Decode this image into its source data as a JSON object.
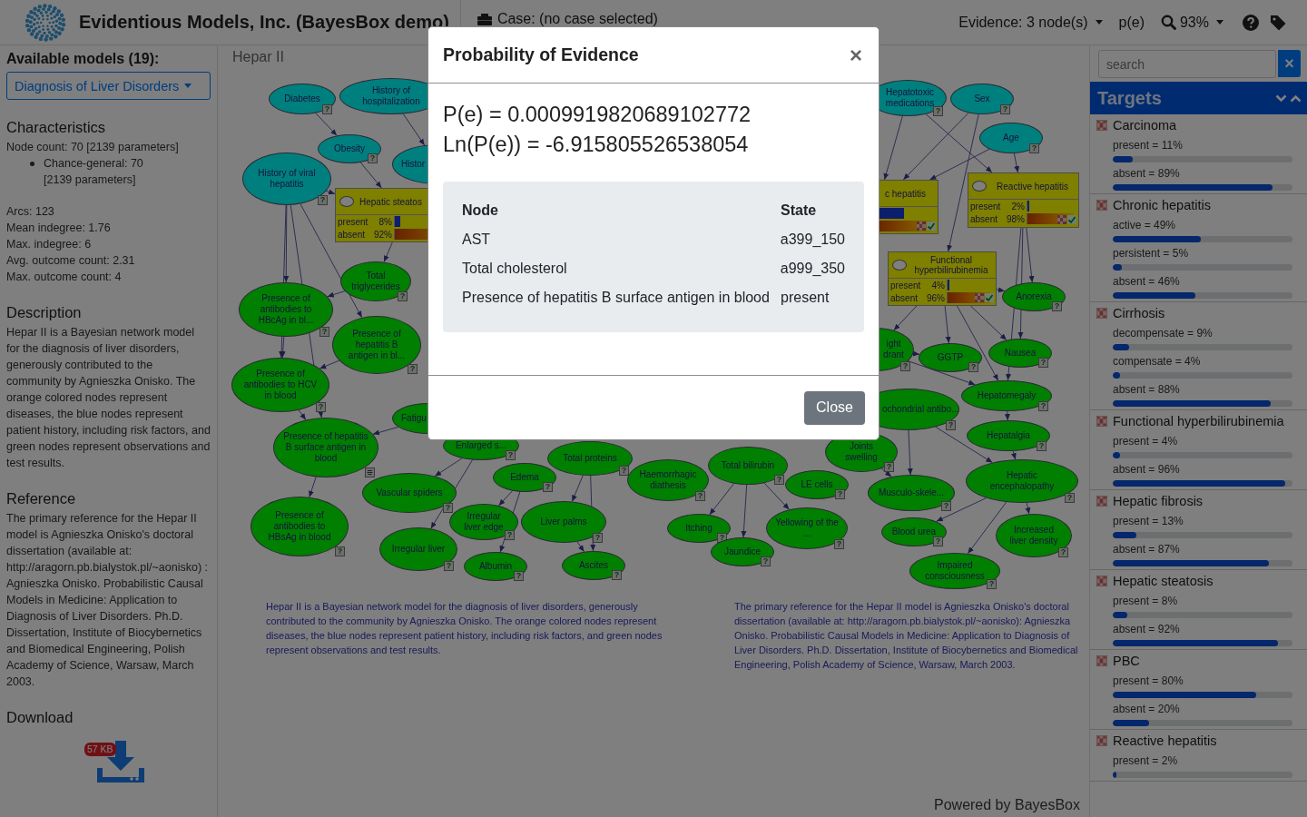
{
  "header": {
    "title": "Evidentious Models, Inc. (BayesBox demo)",
    "case": "Case: (no case selected)",
    "evidence": "Evidence: 3 node(s)",
    "pe": "p(e)",
    "zoom": "93%"
  },
  "sidebar": {
    "heading": "Available models (19):",
    "model": "Diagnosis of Liver Disorders",
    "characteristics": {
      "title": "Characteristics",
      "node_count": "Node count: 70 [2139 parameters]",
      "node_types": [
        "Chance-general: 70 [2139 parameters]"
      ],
      "stats": [
        "Arcs: 123",
        "Mean indegree: 1.76",
        "Max. indegree: 6",
        "Avg. outcome count: 2.31",
        "Max. outcome count: 4"
      ]
    },
    "description": {
      "title": "Description",
      "text": "Hepar II is a Bayesian network model for the diagnosis of liver disorders, generously contributed to the community by Agnieszka Onisko. The orange colored nodes represent diseases, the blue nodes represent patient history, including risk factors, and green nodes represent observations and test results."
    },
    "reference": {
      "title": "Reference",
      "text": "The primary reference for the Hepar II model is Agnieszka Onisko's doctoral dissertation (available at: http://aragorn.pb.bialystok.pl/~aonisko) : Agnieszka Onisko. Probabilistic Causal Models in Medicine: Application to Diagnosis of Liver Disorders. Ph.D. Dissertation, Institute of Biocybernetics and Biomedical Engineering, Polish Academy of Science, Warsaw, March 2003."
    },
    "download": {
      "title": "Download",
      "size": "57 KB"
    }
  },
  "canvas": {
    "title": "Hepar II",
    "nodes": [
      {
        "label": "Diabetes",
        "kind": "history",
        "mark": "?"
      },
      {
        "label": "History of hospitalization",
        "kind": "history"
      },
      {
        "label": "Hepatotoxic medications",
        "kind": "history",
        "mark": "?"
      },
      {
        "label": "Sex",
        "kind": "history",
        "mark": "?"
      },
      {
        "label": "Obesity",
        "kind": "history",
        "mark": "?"
      },
      {
        "label": "History of viral hepatitis",
        "kind": "history",
        "mark": "?"
      },
      {
        "label": "Histor",
        "kind": "history"
      },
      {
        "label": "Age",
        "kind": "history",
        "mark": "?"
      },
      {
        "label": "Presence of antibodies to HBcAg in bl...",
        "kind": "observation",
        "mark": "?"
      },
      {
        "label": "Total triglycerides",
        "kind": "observation",
        "mark": "?"
      },
      {
        "label": "Anorexia",
        "kind": "observation",
        "mark": "?"
      },
      {
        "label": "Presence of antibodies to HCV in blood",
        "kind": "observation",
        "mark": "?"
      },
      {
        "label": "Presence of hepatitis B antigen in bl...",
        "kind": "observation",
        "mark": "?"
      },
      {
        "label": "ight drant",
        "kind": "observation",
        "mark": "?"
      },
      {
        "label": "GGTP",
        "kind": "observation",
        "mark": "?"
      },
      {
        "label": "Nausea",
        "kind": "observation",
        "mark": "?"
      },
      {
        "label": "Presence of hepatitis B surface antigen in blood",
        "kind": "observation",
        "list_badge": true
      },
      {
        "label": "Fatigu",
        "kind": "observation"
      },
      {
        "label": "ochondrial antibo...",
        "kind": "observation",
        "mark": "?"
      },
      {
        "label": "Hepatomegaly",
        "kind": "observation",
        "mark": "?"
      },
      {
        "label": "Enlarged s...",
        "kind": "observation",
        "mark": "?"
      },
      {
        "label": "Presence of antibodies to HBsAg in blood",
        "kind": "observation",
        "mark": "?"
      },
      {
        "label": "Vascular spiders",
        "kind": "observation",
        "mark": "?"
      },
      {
        "label": "Edema",
        "kind": "observation",
        "mark": "?"
      },
      {
        "label": "Total proteins",
        "kind": "observation",
        "mark": "?"
      },
      {
        "label": "Haemorrhagic diathesis",
        "kind": "observation",
        "mark": "?"
      },
      {
        "label": "Total bilirubin",
        "kind": "observation",
        "mark": "?"
      },
      {
        "label": "Joints swelling",
        "kind": "observation",
        "mark": "?"
      },
      {
        "label": "Hepatalgia",
        "kind": "observation",
        "mark": "?"
      },
      {
        "label": "LE cells",
        "kind": "observation",
        "mark": "?"
      },
      {
        "label": "Irregular liver",
        "kind": "observation",
        "mark": "?"
      },
      {
        "label": "Irregular liver edge",
        "kind": "observation",
        "mark": "?"
      },
      {
        "label": "Liver palms",
        "kind": "observation",
        "mark": "?"
      },
      {
        "label": "Itching",
        "kind": "observation",
        "mark": "?"
      },
      {
        "label": "Albumin",
        "kind": "observation",
        "mark": "?"
      },
      {
        "label": "Ascites",
        "kind": "observation",
        "mark": "?"
      },
      {
        "label": "Jaundice",
        "kind": "observation",
        "mark": "?"
      },
      {
        "label": "Yellowing of the ...",
        "kind": "observation",
        "mark": "?"
      },
      {
        "label": "Musculo-skele...",
        "kind": "observation",
        "mark": "?"
      },
      {
        "label": "Hepatic encephalopathy",
        "kind": "observation",
        "mark": "?"
      },
      {
        "label": "Blood urea",
        "kind": "observation",
        "mark": "?"
      },
      {
        "label": "Increased liver density",
        "kind": "observation",
        "mark": "?"
      },
      {
        "label": "Impaired consciousness",
        "kind": "observation",
        "mark": "?"
      }
    ],
    "diseases": [
      {
        "title": "Hepatic steatos",
        "rows": [
          {
            "label": "present",
            "value": "8%",
            "level": 0.08
          },
          {
            "label": "absent",
            "value": "92%",
            "level": 0.92
          }
        ]
      },
      {
        "title": "c hepatitis",
        "rows": [
          {
            "level": 0.49
          },
          {
            "level": 0.95
          }
        ],
        "targeted": true
      },
      {
        "title": "Reactive hepatitis",
        "rows": [
          {
            "label": "present",
            "value": "2%",
            "level": 0.02
          },
          {
            "label": "absent",
            "value": "98%",
            "level": 0.98
          }
        ],
        "targeted": true
      },
      {
        "title": "Functional hyperbilirubinemia",
        "rows": [
          {
            "label": "present",
            "value": "4%",
            "level": 0.04
          },
          {
            "label": "absent",
            "value": "96%",
            "level": 0.96
          }
        ],
        "targeted": true
      }
    ],
    "description": "Hepar II is a Bayesian network model for the diagnosis of liver disorders, generously contributed to the community by Agnieszka Onisko. The orange colored nodes represent diseases, the blue nodes represent patient history, including risk factors, and green nodes represent observations and test results.",
    "reference": "The primary reference for the Hepar II model is Agnieszka Onisko's doctoral dissertation (available at: http://aragorn.pb.bialystok.pl/~aonisko): Agnieszka Onisko. Probabilistic Causal Models in Medicine: Application to Diagnosis of Liver Disorders. Ph.D. Dissertation, Institute of Biocybernetics and Biomedical Engineering, Polish Academy of Science, Warsaw, March 2003.",
    "footer": "Powered by BayesBox"
  },
  "targets_panel": {
    "search": {
      "placeholder": "search"
    },
    "clear": "×",
    "title": "Targets",
    "targets": [
      {
        "name": "Carcinoma",
        "states": [
          {
            "label": "present = 11%",
            "level": 0.11
          },
          {
            "label": "absent = 89%",
            "level": 0.89
          }
        ]
      },
      {
        "name": "Chronic hepatitis",
        "states": [
          {
            "label": "active = 49%",
            "level": 0.49
          },
          {
            "label": "persistent = 5%",
            "level": 0.05
          },
          {
            "label": "absent = 46%",
            "level": 0.46
          }
        ]
      },
      {
        "name": "Cirrhosis",
        "states": [
          {
            "label": "decompensate = 9%",
            "level": 0.09
          },
          {
            "label": "compensate = 4%",
            "level": 0.04
          },
          {
            "label": "absent = 88%",
            "level": 0.88
          }
        ]
      },
      {
        "name": "Functional hyperbilirubinemia",
        "states": [
          {
            "label": "present = 4%",
            "level": 0.04
          },
          {
            "label": "absent = 96%",
            "level": 0.96
          }
        ]
      },
      {
        "name": "Hepatic fibrosis",
        "states": [
          {
            "label": "present = 13%",
            "level": 0.13
          },
          {
            "label": "absent = 87%",
            "level": 0.87
          }
        ]
      },
      {
        "name": "Hepatic steatosis",
        "states": [
          {
            "label": "present = 8%",
            "level": 0.08
          },
          {
            "label": "absent = 92%",
            "level": 0.92
          }
        ]
      },
      {
        "name": "PBC",
        "states": [
          {
            "label": "present = 80%",
            "level": 0.8
          },
          {
            "label": "absent = 20%",
            "level": 0.2
          }
        ]
      },
      {
        "name": "Reactive hepatitis",
        "states": [
          {
            "label": "present = 2%",
            "level": 0.02
          }
        ]
      }
    ]
  },
  "modal": {
    "title": "Probability of Evidence",
    "close_glyph": "×",
    "results": [
      "P(e) = 0.0009919820689102772",
      "Ln(P(e)) = -6.915805526538054"
    ],
    "columns": [
      "Node",
      "State"
    ],
    "rows": [
      {
        "node": "AST",
        "state": "a399_150"
      },
      {
        "node": "Total cholesterol",
        "state": "a999_350"
      },
      {
        "node": "Presence of hepatitis B surface antigen in blood",
        "state": "present"
      }
    ],
    "close_button": "Close"
  }
}
